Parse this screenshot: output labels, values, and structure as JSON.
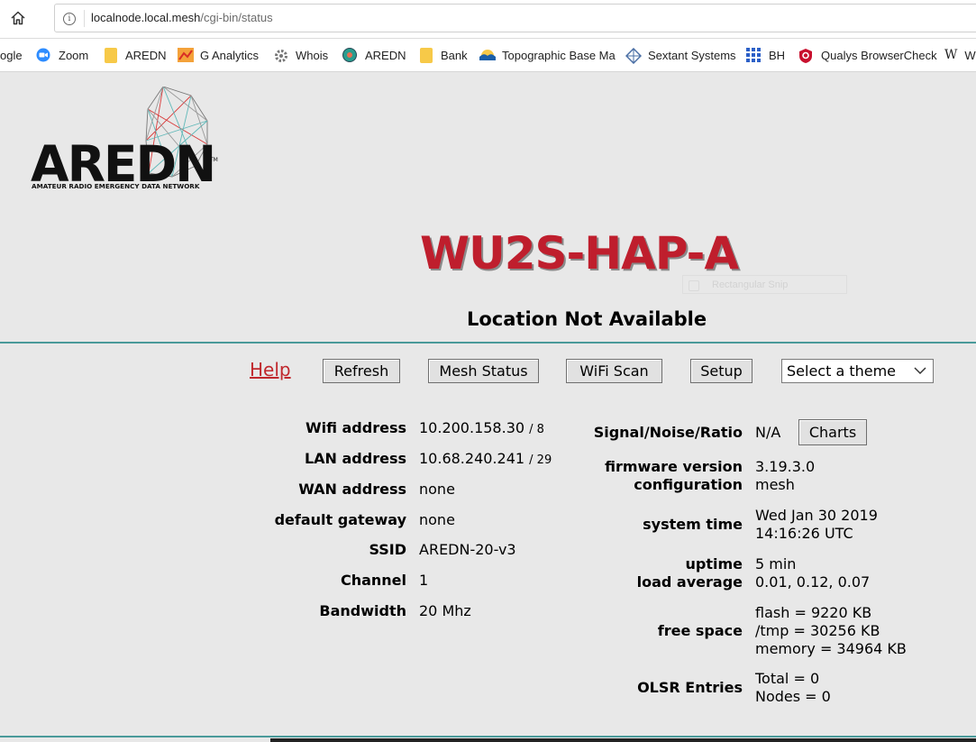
{
  "browser": {
    "url_host": "localnode.local.mesh",
    "url_path": "/cgi-bin/status",
    "bookmarks": [
      "ogle",
      "Zoom",
      "AREDN",
      "G Analytics",
      "Whois",
      "AREDN",
      "Bank",
      "Topographic Base Ma",
      "Sextant Systems",
      "BH",
      "Qualys BrowserCheck",
      "W"
    ]
  },
  "logo": {
    "wordmark": "AREDN",
    "tm": "TM",
    "tagline": "AMATEUR RADIO EMERGENCY DATA NETWORK"
  },
  "header": {
    "node_name": "WU2S-HAP-A",
    "location": "Location Not Available",
    "snip_ghost": "Rectangular Snip"
  },
  "nav": {
    "help": "Help",
    "refresh": "Refresh",
    "mesh_status": "Mesh Status",
    "wifi_scan": "WiFi Scan",
    "setup": "Setup",
    "theme_selected": "Select a theme"
  },
  "left": {
    "wifi_address_label": "Wifi address",
    "wifi_address": "10.200.158.30",
    "wifi_mask": "/ 8",
    "lan_address_label": "LAN address",
    "lan_address": "10.68.240.241",
    "lan_mask": "/ 29",
    "wan_address_label": "WAN address",
    "wan_address": "none",
    "gateway_label": "default gateway",
    "gateway": "none",
    "ssid_label": "SSID",
    "ssid": "AREDN-20-v3",
    "channel_label": "Channel",
    "channel": "1",
    "bandwidth_label": "Bandwidth",
    "bandwidth": "20 Mhz"
  },
  "right": {
    "snr_label": "Signal/Noise/Ratio",
    "snr": "N/A",
    "charts_button": "Charts",
    "firmware_label": "firmware version",
    "firmware": "3.19.3.0",
    "config_label": "configuration",
    "config": "mesh",
    "systime_label": "system time",
    "systime_line1": "Wed Jan 30 2019",
    "systime_line2": "14:16:26 UTC",
    "uptime_label": "uptime",
    "uptime": "5 min",
    "load_label": "load average",
    "load": "0.01, 0.12, 0.07",
    "free_label": "free space",
    "free_flash": "flash = 9220 KB",
    "free_tmp": "/tmp = 30256 KB",
    "free_memory": "memory = 34964 KB",
    "olsr_label": "OLSR Entries",
    "olsr_total": "Total = 0",
    "olsr_nodes": "Nodes = 0"
  }
}
